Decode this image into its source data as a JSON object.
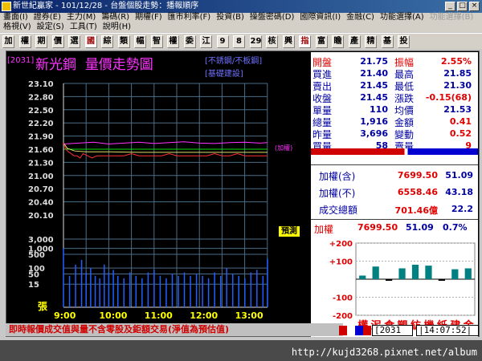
{
  "window": {
    "title": "新世紀贏家 - 101/12/28 - 台盤個股走勢：播報順序"
  },
  "menu": {
    "row1": [
      "畫面(I)",
      "證券(E)",
      "主力(M)",
      "籌碼(R)",
      "期權(F)",
      "匯市利率(F)",
      "投資(B)",
      "操盤密碼(D)",
      "國際資訊(I)",
      "金融(C)",
      "功能選擇(A)",
      "功能選擇(B)"
    ],
    "row2": [
      "格視(V)",
      "設定(S)",
      "工具(T)",
      "說明(H)"
    ]
  },
  "toolbar": [
    "加",
    "權",
    "期",
    "價",
    "選",
    "國",
    "綜",
    "類",
    "幅",
    "智",
    "權",
    "委",
    "江",
    "9",
    "8",
    "29",
    "核",
    "興",
    "指",
    "富",
    "瞻",
    "產",
    "精",
    "基",
    "投"
  ],
  "header": {
    "code_tag": "[2031]",
    "stock_name": "新光鋼",
    "chart_title": "量價走勢圖",
    "tag1": "[不銹鋼/不板鋼]",
    "tag2": "[基礎建設]"
  },
  "chart_data": {
    "type": "line",
    "price_ticks": [
      "23.10",
      "22.80",
      "22.50",
      "22.20",
      "21.90",
      "21.60",
      "21.30",
      "21.00",
      "20.70",
      "20.40",
      "20.10"
    ],
    "price_range": [
      20.1,
      23.1
    ],
    "highlight_ticks": [
      "21.60"
    ],
    "volume_ticks": [
      "3,000",
      "1,000",
      "500",
      "100",
      "50",
      "15"
    ],
    "volume_unit": "張",
    "x_ticks": [
      "9:00",
      "10:00",
      "11:00",
      "12:00",
      "13:00"
    ],
    "reference_price": 21.6,
    "adjusted_label": "(加權)",
    "price_series": [
      [
        0,
        21.75
      ],
      [
        3,
        21.6
      ],
      [
        6,
        21.55
      ],
      [
        10,
        21.5
      ],
      [
        14,
        21.45
      ],
      [
        18,
        21.45
      ],
      [
        22,
        21.4
      ],
      [
        26,
        21.5
      ],
      [
        32,
        21.45
      ],
      [
        38,
        21.4
      ],
      [
        44,
        21.45
      ],
      [
        50,
        21.45
      ],
      [
        60,
        21.45
      ],
      [
        70,
        21.45
      ],
      [
        80,
        21.45
      ],
      [
        90,
        21.5
      ],
      [
        100,
        21.45
      ],
      [
        110,
        21.45
      ],
      [
        120,
        21.45
      ],
      [
        130,
        21.45
      ],
      [
        140,
        21.5
      ],
      [
        150,
        21.45
      ],
      [
        160,
        21.45
      ],
      [
        170,
        21.45
      ],
      [
        180,
        21.45
      ],
      [
        190,
        21.45
      ],
      [
        200,
        21.5
      ],
      [
        210,
        21.45
      ],
      [
        220,
        21.45
      ],
      [
        230,
        21.5
      ],
      [
        240,
        21.45
      ],
      [
        250,
        21.45
      ],
      [
        260,
        21.45
      ],
      [
        270,
        21.45
      ]
    ],
    "avg_series": [
      [
        0,
        21.75
      ],
      [
        5,
        21.62
      ],
      [
        15,
        21.56
      ],
      [
        30,
        21.54
      ],
      [
        60,
        21.54
      ],
      [
        100,
        21.53
      ],
      [
        150,
        21.53
      ],
      [
        200,
        21.53
      ],
      [
        270,
        21.53
      ]
    ],
    "index_series": [
      [
        0,
        21.72
      ],
      [
        20,
        21.74
      ],
      [
        40,
        21.76
      ],
      [
        60,
        21.72
      ],
      [
        80,
        21.74
      ],
      [
        100,
        21.76
      ],
      [
        120,
        21.73
      ],
      [
        140,
        21.75
      ],
      [
        160,
        21.77
      ],
      [
        180,
        21.74
      ],
      [
        200,
        21.73
      ],
      [
        220,
        21.75
      ],
      [
        240,
        21.76
      ],
      [
        260,
        21.74
      ],
      [
        270,
        21.75
      ]
    ],
    "volume_series": [
      [
        0,
        1000
      ],
      [
        8,
        40
      ],
      [
        16,
        150
      ],
      [
        24,
        260
      ],
      [
        30,
        60
      ],
      [
        36,
        100
      ],
      [
        42,
        40
      ],
      [
        48,
        30
      ],
      [
        54,
        150
      ],
      [
        60,
        60
      ],
      [
        66,
        80
      ],
      [
        72,
        40
      ],
      [
        80,
        30
      ],
      [
        88,
        60
      ],
      [
        96,
        40
      ],
      [
        104,
        30
      ],
      [
        112,
        60
      ],
      [
        120,
        80
      ],
      [
        128,
        40
      ],
      [
        136,
        30
      ],
      [
        144,
        50
      ],
      [
        152,
        40
      ],
      [
        160,
        60
      ],
      [
        168,
        40
      ],
      [
        176,
        50
      ],
      [
        184,
        40
      ],
      [
        192,
        30
      ],
      [
        200,
        60
      ],
      [
        208,
        40
      ],
      [
        216,
        100
      ],
      [
        224,
        50
      ],
      [
        232,
        40
      ],
      [
        240,
        30
      ],
      [
        248,
        60
      ],
      [
        256,
        80
      ],
      [
        264,
        40
      ],
      [
        270,
        300
      ]
    ]
  },
  "quote": {
    "rows": [
      {
        "l1": "開盤",
        "v1": "21.75",
        "l2": "振幅",
        "v2": "2.55%"
      },
      {
        "l1": "買進",
        "v1": "21.40",
        "l2": "最高",
        "v2": "21.85"
      },
      {
        "l1": "賣出",
        "v1": "21.45",
        "l2": "最低",
        "v2": "21.30"
      },
      {
        "l1": "收盤",
        "v1": "21.45",
        "l2": "漲跌",
        "v2": "-0.15(68)"
      },
      {
        "l1": "單量",
        "v1": "110",
        "l2": "均價",
        "v2": "21.53"
      },
      {
        "l1": "總量",
        "v1": "1,916",
        "l2": "金額",
        "v2": "0.41"
      },
      {
        "l1": "昨量",
        "v1": "3,696",
        "l2": "變動",
        "v2": "0.52"
      },
      {
        "l1": "買量",
        "v1": "58",
        "l2": "賣量",
        "v2": "9"
      }
    ]
  },
  "index": {
    "rows": [
      {
        "label": "加權(含)",
        "value": "7699.50",
        "change": "51.09"
      },
      {
        "label": "加權(不)",
        "value": "6558.46",
        "change": "43.18"
      },
      {
        "label": "成交總額",
        "value": "701.46億",
        "change": "22.2"
      }
    ],
    "line": {
      "label": "加權",
      "value": "7699.50",
      "change": "51.09",
      "pct": "0.7%"
    }
  },
  "sector": {
    "y_ticks": [
      "+200",
      "+100",
      "-100",
      "-200"
    ],
    "labels": [
      "權",
      "泥",
      "食",
      "塑",
      "紡",
      "機",
      "紙",
      "建",
      "金"
    ],
    "values": [
      20,
      70,
      -5,
      60,
      80,
      75,
      -8,
      55,
      60
    ]
  },
  "pre_badge": "預測",
  "status": {
    "notice": "即時報價成交值與量不含零股及鉅額交易(淨值為預估值)",
    "code": "2031",
    "time": "14:07:52"
  },
  "watermark": "http://kujd3268.pixnet.net/album"
}
